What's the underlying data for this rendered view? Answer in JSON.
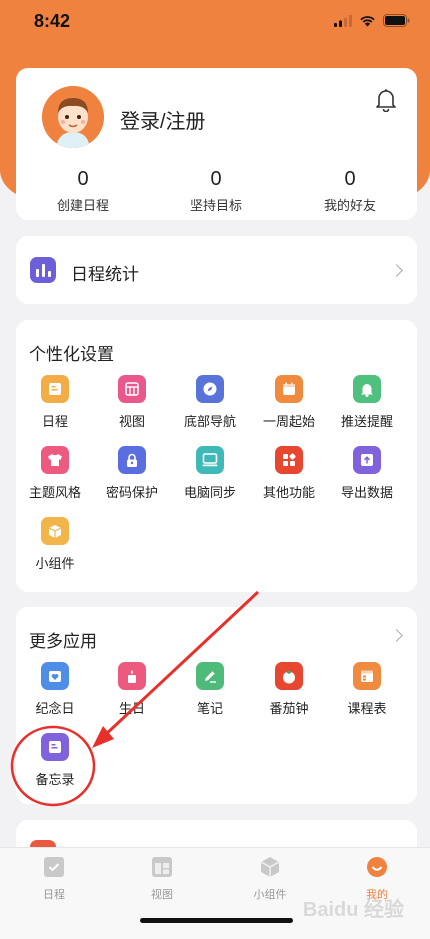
{
  "status_bar": {
    "time": "8:42"
  },
  "profile": {
    "login_label": "登录/注册",
    "stats": [
      {
        "value": "0",
        "label": "创建日程"
      },
      {
        "value": "0",
        "label": "坚持目标"
      },
      {
        "value": "0",
        "label": "我的好友"
      }
    ]
  },
  "schedule_stats": {
    "label": "日程统计"
  },
  "personalization": {
    "title": "个性化设置",
    "items": [
      {
        "label": "日程",
        "icon": "schedule-icon",
        "color": "#f2ad46"
      },
      {
        "label": "视图",
        "icon": "view-grid-icon",
        "color": "#e9578d"
      },
      {
        "label": "底部导航",
        "icon": "compass-icon",
        "color": "#5874d8"
      },
      {
        "label": "一周起始",
        "icon": "calendar-icon",
        "color": "#ef8a3f"
      },
      {
        "label": "推送提醒",
        "icon": "bell-icon",
        "color": "#4fc07e"
      },
      {
        "label": "主题风格",
        "icon": "shirt-icon",
        "color": "#ec5b7f"
      },
      {
        "label": "密码保护",
        "icon": "lock-icon",
        "color": "#5b6ee0"
      },
      {
        "label": "电脑同步",
        "icon": "monitor-icon",
        "color": "#3fb9b8"
      },
      {
        "label": "其他功能",
        "icon": "apps-icon",
        "color": "#e8472f"
      },
      {
        "label": "导出数据",
        "icon": "export-icon",
        "color": "#7f62dc"
      },
      {
        "label": "小组件",
        "icon": "cube-icon",
        "color": "#f2b54a"
      }
    ]
  },
  "more_apps": {
    "title": "更多应用",
    "items": [
      {
        "label": "纪念日",
        "icon": "anniversary-icon",
        "color": "#4f8ee6"
      },
      {
        "label": "生日",
        "icon": "birthday-icon",
        "color": "#ec5b7f"
      },
      {
        "label": "笔记",
        "icon": "pencil-icon",
        "color": "#4fbb7a"
      },
      {
        "label": "番茄钟",
        "icon": "tomato-icon",
        "color": "#e8472f"
      },
      {
        "label": "课程表",
        "icon": "timetable-icon",
        "color": "#ef8a3f"
      },
      {
        "label": "备忘录",
        "icon": "memo-icon",
        "color": "#7f62dc"
      }
    ]
  },
  "tabbar": {
    "tabs": [
      {
        "label": "日程"
      },
      {
        "label": "视图"
      },
      {
        "label": "小组件"
      },
      {
        "label": "我的",
        "active": true
      }
    ]
  },
  "colors": {
    "accent": "#f0823f",
    "annotation": "#e8302a"
  }
}
